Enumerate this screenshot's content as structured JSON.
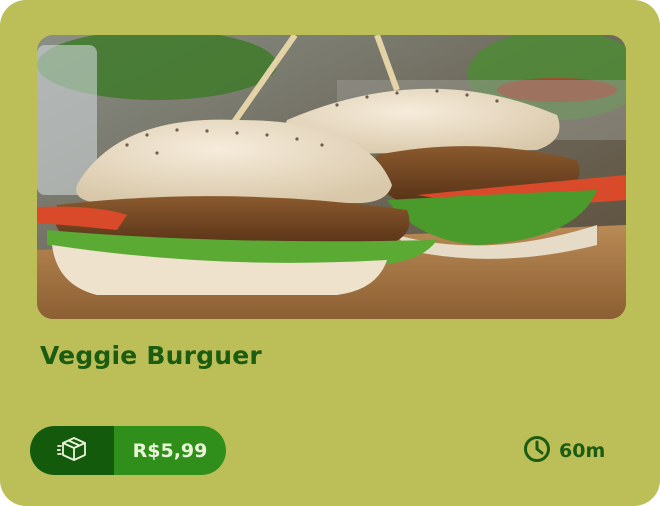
{
  "product": {
    "name": "Veggie Burguer",
    "image_alt": "Veggie burger photo",
    "price": "R$5,99",
    "prep_time": "60m",
    "delivery_icon": "delivery-box-icon",
    "time_icon": "clock-icon"
  },
  "colors": {
    "card_bg": "#bcbe58",
    "title": "#1c5c10",
    "pill_dark": "#145a0c",
    "pill_light": "#2f8f1a"
  }
}
